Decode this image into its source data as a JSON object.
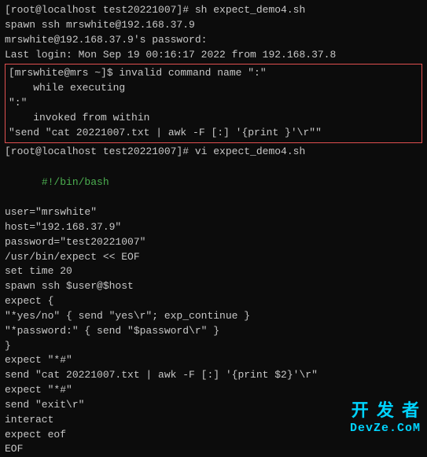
{
  "terminal": {
    "lines_top": [
      {
        "id": "cmd1",
        "text": "[root@localhost test20221007]# sh expect_demo4.sh",
        "type": "prompt"
      },
      {
        "id": "spawn1",
        "text": "spawn ssh mrswhite@192.168.37.9",
        "type": "normal"
      },
      {
        "id": "password_prompt",
        "text": "mrswhite@192.168.37.9's password:",
        "type": "normal"
      },
      {
        "id": "last_login",
        "text": "Last login: Mon Sep 19 00:16:17 2022 from 192.168.37.8",
        "type": "normal"
      }
    ],
    "error_box": {
      "line1": "[mrswhite@mrs ~]$ invalid command name \":\"",
      "line2": "    while executing",
      "line3": "\":\"",
      "line4": "    invoked from within",
      "line5": "\"send \"cat 20221007.txt | awk -F [:] '{print }'\\r\"\""
    },
    "after_error": [
      {
        "id": "cmd2",
        "text": "[root@localhost test20221007]# vi expect_demo4.sh",
        "type": "prompt"
      }
    ],
    "script_lines": [
      {
        "id": "shebang",
        "text": "#!/bin/bash",
        "type": "shebang"
      },
      {
        "id": "s1",
        "text": "user=\"mrswhite\"",
        "type": "normal"
      },
      {
        "id": "s2",
        "text": "host=\"192.168.37.9\"",
        "type": "normal"
      },
      {
        "id": "s3",
        "text": "password=\"test20221007\"",
        "type": "normal"
      },
      {
        "id": "s4",
        "text": "/usr/bin/expect << EOF",
        "type": "normal"
      },
      {
        "id": "s5",
        "text": "set time 20",
        "type": "normal"
      },
      {
        "id": "s6",
        "text": "spawn ssh $user@$host",
        "type": "normal"
      },
      {
        "id": "s7",
        "text": "expect {",
        "type": "normal"
      },
      {
        "id": "s8",
        "text": "\"*yes/no\" { send \"yes\\r\"; exp_continue }",
        "type": "normal"
      },
      {
        "id": "s9",
        "text": "\"*password:\" { send \"$password\\r\" }",
        "type": "normal"
      },
      {
        "id": "s10",
        "text": "}",
        "type": "normal"
      },
      {
        "id": "s11",
        "text": "expect \"*#\"",
        "type": "normal"
      },
      {
        "id": "s12",
        "text": "send \"cat 20221007.txt | awk -F [:] '{print $2}'\\r\"",
        "type": "normal"
      },
      {
        "id": "s13",
        "text": "expect \"*#\"",
        "type": "normal"
      },
      {
        "id": "s14",
        "text": "send \"exit\\r\"",
        "type": "normal"
      },
      {
        "id": "s15",
        "text": "interact",
        "type": "normal"
      },
      {
        "id": "s16",
        "text": "expect eof",
        "type": "normal"
      },
      {
        "id": "s17",
        "text": "EOF",
        "type": "normal"
      }
    ],
    "watermark": {
      "top": "开 发 者",
      "bottom": "DevZe.CoM"
    }
  }
}
